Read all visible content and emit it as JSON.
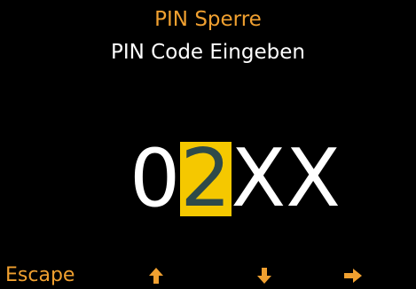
{
  "screen": {
    "title": "PIN Sperre",
    "subtitle": "PIN Code Eingeben"
  },
  "pin": {
    "digits": [
      "0",
      "2",
      "X",
      "X"
    ],
    "active_index": 1
  },
  "softkeys": {
    "escape_label": "Escape",
    "up_icon": "arrow-up-icon",
    "down_icon": "arrow-down-icon",
    "right_icon": "arrow-right-icon"
  },
  "colors": {
    "background": "#000000",
    "accent": "#F0A030",
    "text": "#FFFFFF",
    "highlight": "#F5C800",
    "highlight_text": "#2E4A4A"
  }
}
